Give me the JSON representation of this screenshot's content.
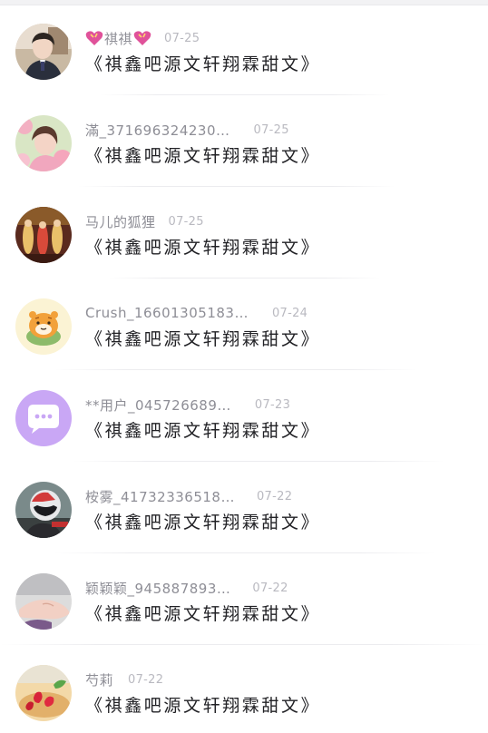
{
  "comments": [
    {
      "name": "祺祺",
      "date": "07-25",
      "text": "《祺鑫吧源文轩翔霖甜文》",
      "avatar": "boy-in-suit-photo",
      "hearts": true
    },
    {
      "name": "滿_371696324230…",
      "date": "07-25",
      "text": "《祺鑫吧源文轩翔霖甜文》",
      "avatar": "girl-with-flowers-photo"
    },
    {
      "name": "马儿的狐狸",
      "date": "07-25",
      "text": "《祺鑫吧源文轩翔霖甜文》",
      "avatar": "stage-performance-photo"
    },
    {
      "name": "Crush_16601305183…",
      "date": "07-24",
      "text": "《祺鑫吧源文轩翔霖甜文》",
      "avatar": "cartoon-hamster"
    },
    {
      "name": "**用户_045726689…",
      "date": "07-23",
      "text": "《祺鑫吧源文轩翔霖甜文》",
      "avatar": "chat-bubble-default-avatar"
    },
    {
      "name": "桉雾_41732336518…",
      "date": "07-22",
      "text": "《祺鑫吧源文轩翔霖甜文》",
      "avatar": "helmet-motorcycle-photo"
    },
    {
      "name": "颖颖颖_945887893…",
      "date": "07-22",
      "text": "《祺鑫吧源文轩翔霖甜文》",
      "avatar": "hand-photo"
    },
    {
      "name": "芍莉",
      "date": "07-22",
      "text": "《祺鑫吧源文轩翔霖甜文》",
      "avatar": "strawberry-dessert-photo"
    }
  ],
  "colors": {
    "name": "#8e8e96",
    "date": "#b9b9c0",
    "text": "#222226",
    "default_avatar": "#c9a7f5",
    "heart": "#e0529a"
  }
}
